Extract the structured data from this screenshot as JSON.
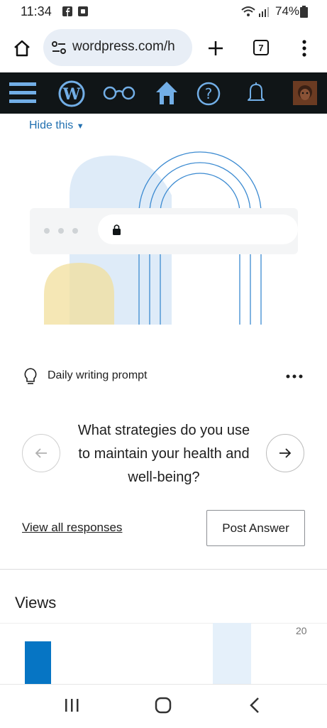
{
  "status_bar": {
    "time": "11:34",
    "battery": "74%"
  },
  "browser": {
    "url": "wordpress.com/h",
    "tab_count": "7"
  },
  "dashboard": {
    "hide_label": "Hide this"
  },
  "prompt": {
    "label": "Daily writing prompt",
    "question": "What strategies do you use to maintain your health and well-being?",
    "view_all": "View all responses",
    "post_answer": "Post Answer"
  },
  "views": {
    "title": "Views",
    "chart_data": {
      "type": "bar",
      "y_tick": "20"
    }
  },
  "colors": {
    "accent": "#2271b1",
    "wp_bar": "#101517",
    "bar": "#0675c4"
  }
}
